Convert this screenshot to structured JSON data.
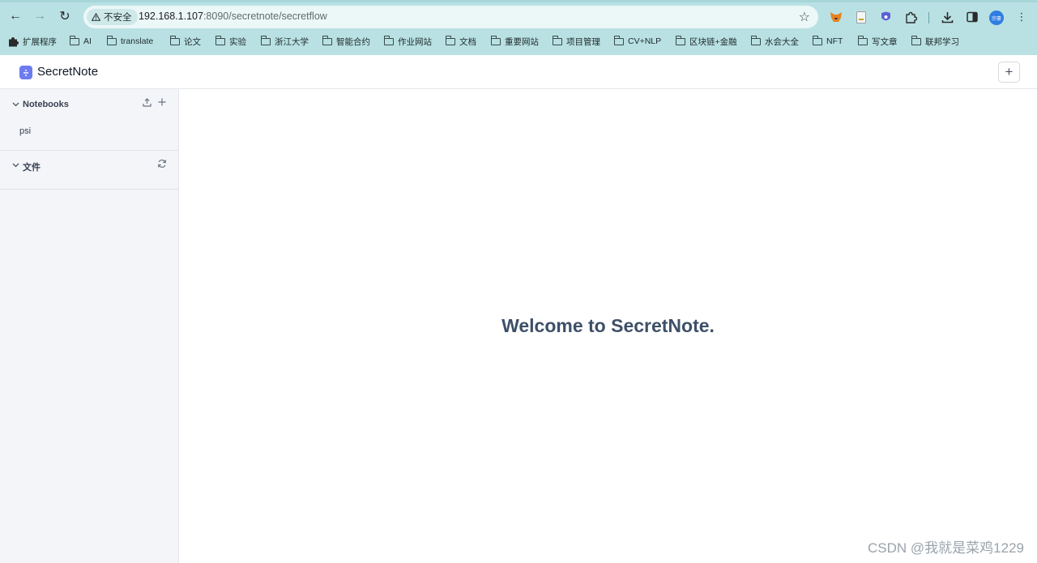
{
  "browser": {
    "nav": {
      "back": "←",
      "forward": "→",
      "reload": "↻"
    },
    "security_label": "不安全",
    "url_host": "192.168.1.107",
    "url_rest": ":8090/secretnote/secretflow",
    "star": "☆",
    "extensions": [
      "metamask-icon",
      "document-icon",
      "wallet-icon",
      "puzzle-icon",
      "download-icon",
      "sidepanel-icon"
    ],
    "avatar_text": "宗豪",
    "menu": "⋮",
    "bookmarks": [
      {
        "label": "扩展程序",
        "icon": "puzzle-icon"
      },
      {
        "label": "AI"
      },
      {
        "label": "translate"
      },
      {
        "label": "论文"
      },
      {
        "label": "实验"
      },
      {
        "label": "浙江大学"
      },
      {
        "label": "智能合约"
      },
      {
        "label": "作业网站"
      },
      {
        "label": "文档"
      },
      {
        "label": "重要网站"
      },
      {
        "label": "项目管理"
      },
      {
        "label": "CV+NLP"
      },
      {
        "label": "区块链+金融"
      },
      {
        "label": "水会大全"
      },
      {
        "label": "NFT"
      },
      {
        "label": "写文章"
      },
      {
        "label": "联邦学习"
      }
    ]
  },
  "app": {
    "title": "SecretNote",
    "add_label": "+"
  },
  "sidebar": {
    "notebooks": {
      "title": "Notebooks",
      "items": [
        "psi"
      ]
    },
    "files": {
      "title": "文件"
    }
  },
  "main": {
    "welcome": "Welcome to SecretNote."
  },
  "watermark": "CSDN @我就是菜鸡1229"
}
